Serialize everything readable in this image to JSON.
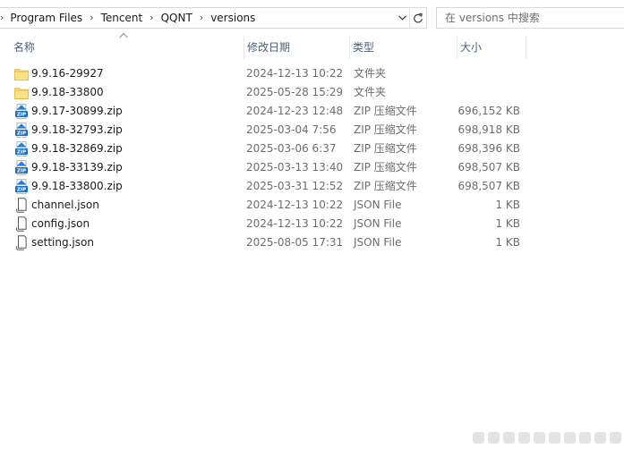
{
  "address_bar": {
    "crumbs": [
      "Program Files",
      "Tencent",
      "QQNT",
      "versions"
    ]
  },
  "search": {
    "placeholder": "在 versions 中搜索"
  },
  "columns": {
    "name": "名称",
    "date": "修改日期",
    "type": "类型",
    "size": "大小"
  },
  "files": [
    {
      "icon": "folder-icon",
      "name": "9.9.16-29927",
      "date": "2024-12-13 10:22",
      "type": "文件夹",
      "size": ""
    },
    {
      "icon": "folder-icon",
      "name": "9.9.18-33800",
      "date": "2025-05-28 15:29",
      "type": "文件夹",
      "size": ""
    },
    {
      "icon": "zip-icon",
      "name": "9.9.17-30899.zip",
      "date": "2024-12-23 12:48",
      "type": "ZIP 压缩文件",
      "size": "696,152 KB"
    },
    {
      "icon": "zip-icon",
      "name": "9.9.18-32793.zip",
      "date": "2025-03-04 7:56",
      "type": "ZIP 压缩文件",
      "size": "698,918 KB"
    },
    {
      "icon": "zip-icon",
      "name": "9.9.18-32869.zip",
      "date": "2025-03-06 6:37",
      "type": "ZIP 压缩文件",
      "size": "698,396 KB"
    },
    {
      "icon": "zip-icon",
      "name": "9.9.18-33139.zip",
      "date": "2025-03-13 13:40",
      "type": "ZIP 压缩文件",
      "size": "698,507 KB"
    },
    {
      "icon": "zip-icon",
      "name": "9.9.18-33800.zip",
      "date": "2025-03-31 12:52",
      "type": "ZIP 压缩文件",
      "size": "698,507 KB"
    },
    {
      "icon": "json-file-icon",
      "name": "channel.json",
      "date": "2024-12-13 10:22",
      "type": "JSON File",
      "size": "1 KB"
    },
    {
      "icon": "json-file-icon",
      "name": "config.json",
      "date": "2024-12-13 10:22",
      "type": "JSON File",
      "size": "1 KB"
    },
    {
      "icon": "json-file-icon",
      "name": "setting.json",
      "date": "2025-08-05 17:31",
      "type": "JSON File",
      "size": "1 KB"
    }
  ],
  "colors": {
    "header_text": "#4c607a",
    "secondary_text": "#6d6d6d",
    "folder": "#f7d674",
    "zip_blue": "#2a7fd4"
  }
}
